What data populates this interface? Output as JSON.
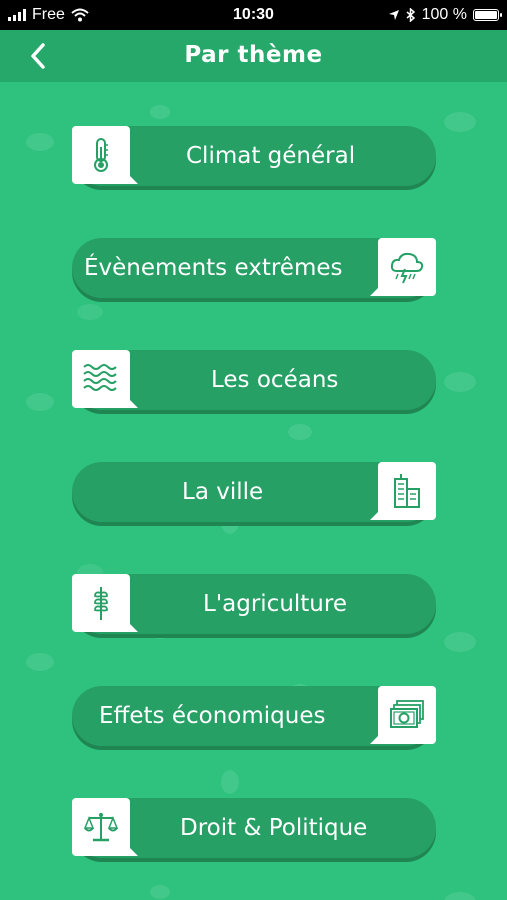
{
  "status_bar": {
    "carrier": "Free",
    "time": "10:30",
    "battery": "100 %"
  },
  "header": {
    "title": "Par thème",
    "back_icon": "chevron-left-icon"
  },
  "themes": [
    {
      "label": "Climat général",
      "icon": "thermometer-icon",
      "icon_side": "left"
    },
    {
      "label": "Évènements extrêmes",
      "icon": "storm-cloud-icon",
      "icon_side": "right"
    },
    {
      "label": "Les océans",
      "icon": "waves-icon",
      "icon_side": "left"
    },
    {
      "label": "La ville",
      "icon": "city-buildings-icon",
      "icon_side": "right"
    },
    {
      "label": "L'agriculture",
      "icon": "wheat-icon",
      "icon_side": "left"
    },
    {
      "label": "Effets économiques",
      "icon": "banknotes-icon",
      "icon_side": "right"
    },
    {
      "label": "Droit & Politique",
      "icon": "scales-icon",
      "icon_side": "left"
    }
  ],
  "colors": {
    "background": "#2ec27e",
    "header": "#26a86b",
    "button": "#27a066",
    "icon_stroke": "#27a066"
  }
}
